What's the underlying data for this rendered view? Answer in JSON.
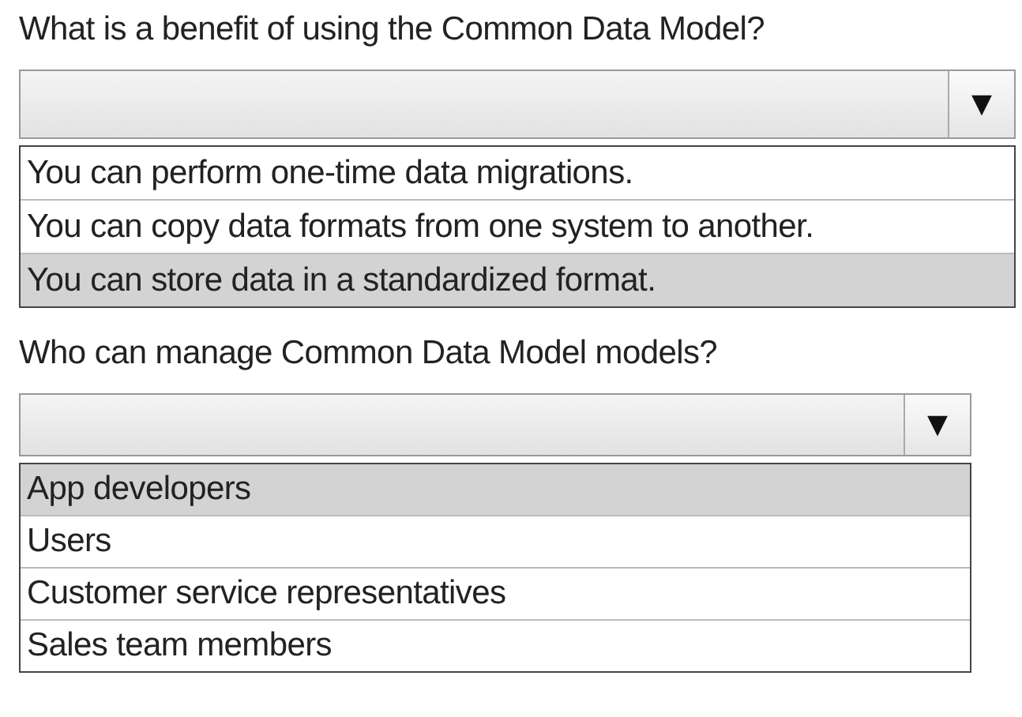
{
  "questions": [
    {
      "text": "What is a benefit of using the Common Data Model?",
      "arrow": "▼",
      "options": [
        {
          "text": "You can perform one-time data migrations.",
          "selected": false
        },
        {
          "text": "You can copy data formats from one system to another.",
          "selected": false
        },
        {
          "text": "You can store data in a standardized format.",
          "selected": true
        }
      ]
    },
    {
      "text": "Who can manage Common Data Model models?",
      "arrow": "▼",
      "options": [
        {
          "text": "App developers",
          "selected": true
        },
        {
          "text": "Users",
          "selected": false
        },
        {
          "text": "Customer service representatives",
          "selected": false
        },
        {
          "text": "Sales team members",
          "selected": false
        }
      ]
    }
  ]
}
